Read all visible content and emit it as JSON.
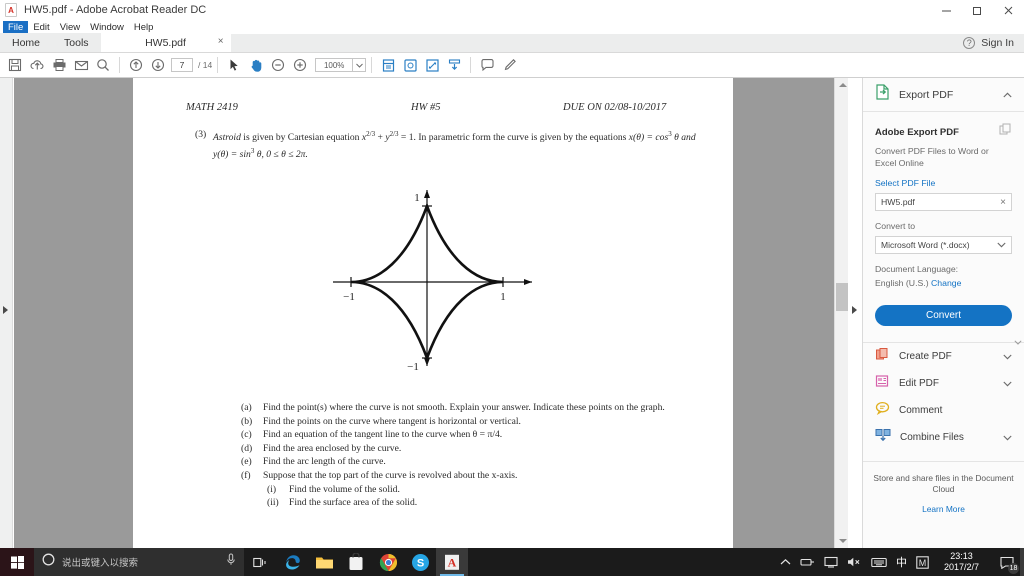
{
  "window": {
    "title": "HW5.pdf - Adobe Acrobat Reader DC",
    "app_icon": "pdf-file-icon",
    "minimize": "minimize-icon",
    "restore": "restore-icon",
    "close": "close-icon"
  },
  "menu": {
    "items": [
      {
        "label": "File",
        "active": true
      },
      {
        "label": "Edit",
        "active": false
      },
      {
        "label": "View",
        "active": false
      },
      {
        "label": "Window",
        "active": false
      },
      {
        "label": "Help",
        "active": false
      }
    ]
  },
  "tabs": {
    "home": "Home",
    "tools": "Tools",
    "document": "HW5.pdf",
    "close_label": "×",
    "help_label": "?",
    "sign_in": "Sign In"
  },
  "toolbar": {
    "icons": [
      "save-icon",
      "upload-cloud-icon",
      "print-icon",
      "email-icon",
      "search-icon",
      "previous-page-icon",
      "next-page-icon"
    ],
    "page_current": "7",
    "page_total": "/ 14",
    "select_tool": "select-cursor-icon",
    "hand_tool": "hand-tool-icon",
    "zoom_out": "zoom-out-icon",
    "zoom_in": "zoom-in-icon",
    "zoom_level": "100%",
    "zoom_dropdown": "chevron-down-icon",
    "fit_page": "fit-page-icon",
    "rotate": "rotate-page-icon",
    "fullscreen": "fullscreen-icon",
    "scroll_down": "scroll-mode-icon",
    "comment": "comment-bubble-icon",
    "highlight": "highlight-pen-icon"
  },
  "document": {
    "header": {
      "course": "MATH 2419",
      "assignment": "HW #5",
      "due": "DUE ON 02/08-10/2017"
    },
    "problem": {
      "number": "(3)",
      "text_lead": "Astroid",
      "text_a": " is given by Cartesian equation ",
      "eq1": "x",
      "eq1_sup": "2/3",
      "eq1_plus": " + ",
      "eq2": "y",
      "eq2_sup": "2/3",
      "eq1_end": " = 1. In parametric form the curve is given by the equations ",
      "eq3": "x(θ) = cos",
      "eq3_sup": "3",
      "eq3_b": " θ and ",
      "eq4": "y(θ) = sin",
      "eq4_sup": "3",
      "eq4_b": " θ, 0 ≤ θ ≤ 2π."
    },
    "subproblems": [
      {
        "label": "(a)",
        "text": "Find the point(s) where the curve is not smooth. Explain your answer. Indicate these points on the graph.",
        "indent": 1
      },
      {
        "label": "(b)",
        "text": "Find the points on the curve where tangent is horizontal or vertical.",
        "indent": 1
      },
      {
        "label": "(c)",
        "text": "Find an equation of the tangent line to the curve when θ = π/4.",
        "indent": 1
      },
      {
        "label": "(d)",
        "text": "Find the area enclosed by the curve.",
        "indent": 1
      },
      {
        "label": "(e)",
        "text": "Find the arc length of the curve.",
        "indent": 1
      },
      {
        "label": "(f)",
        "text": "Suppose that the top part of the curve is revolved about the x-axis.",
        "indent": 1
      },
      {
        "label": "(i)",
        "text": "Find the volume of the solid.",
        "indent": 2
      },
      {
        "label": "(ii)",
        "text": "Find the surface area of the solid.",
        "indent": 2
      }
    ],
    "graph": {
      "name": "astroid-curve-plot",
      "x_axis_label_neg": "−1",
      "x_axis_label_pos": "1",
      "y_axis_label_pos": "1",
      "y_axis_label_neg": "−1"
    }
  },
  "sidebar": {
    "header": {
      "title": "Export PDF",
      "icon": "export-pdf-icon",
      "chevron": "chevron-up-icon"
    },
    "panel_title": "Adobe Export PDF",
    "copy_icon": "copy-icon",
    "description": "Convert PDF Files to Word or Excel Online",
    "select_file_link": "Select PDF File",
    "selected_file": "HW5.pdf",
    "clear_icon": "×",
    "convert_to_label": "Convert to",
    "convert_to_value": "Microsoft Word (*.docx)",
    "language_label": "Document Language:",
    "language_value": "English (U.S.)",
    "language_change": "Change",
    "convert_button": "Convert",
    "tools": [
      {
        "label": "Create PDF",
        "icon": "create-pdf-icon",
        "chevron": "chevron-down-icon",
        "color": "#e8705a"
      },
      {
        "label": "Edit PDF",
        "icon": "edit-pdf-icon",
        "chevron": "chevron-down-icon",
        "color": "#e06bb0"
      },
      {
        "label": "Comment",
        "icon": "comment-icon",
        "chevron": "",
        "color": "#e8c040"
      },
      {
        "label": "Combine Files",
        "icon": "combine-files-icon",
        "chevron": "chevron-down-icon",
        "color": "#4a86c8"
      }
    ],
    "footer_text": "Store and share files in the Document Cloud",
    "footer_link": "Learn More"
  },
  "taskbar": {
    "start_icon": "windows-start-icon",
    "search_placeholder": "说出或键入以搜索",
    "cortana_icon": "cortana-circle-icon",
    "mic_icon": "microphone-icon",
    "task_view_icon": "task-view-icon",
    "apps": [
      {
        "name": "edge-icon",
        "active": false
      },
      {
        "name": "file-explorer-icon",
        "active": false
      },
      {
        "name": "store-icon",
        "active": false
      },
      {
        "name": "chrome-icon",
        "active": false
      },
      {
        "name": "skype-icon",
        "active": false
      },
      {
        "name": "acrobat-reader-icon",
        "active": true
      }
    ],
    "tray": [
      "show-hidden-icons-chevron",
      "network-adapter-icon",
      "display-icon",
      "volume-muted-icon",
      "keyboard-icon",
      "ime-chinese-icon",
      "onenote-icon"
    ],
    "ime_label": "中",
    "onenote_label": "M",
    "time": "23:13",
    "date": "2017/2/7",
    "notification_icon": "action-center-icon",
    "notification_count": "18"
  },
  "colors": {
    "accent_blue": "#1473c4",
    "menu_highlight": "#1a6fc4",
    "doc_background": "#9a9a9a",
    "taskbar": "#1b1b1b"
  }
}
